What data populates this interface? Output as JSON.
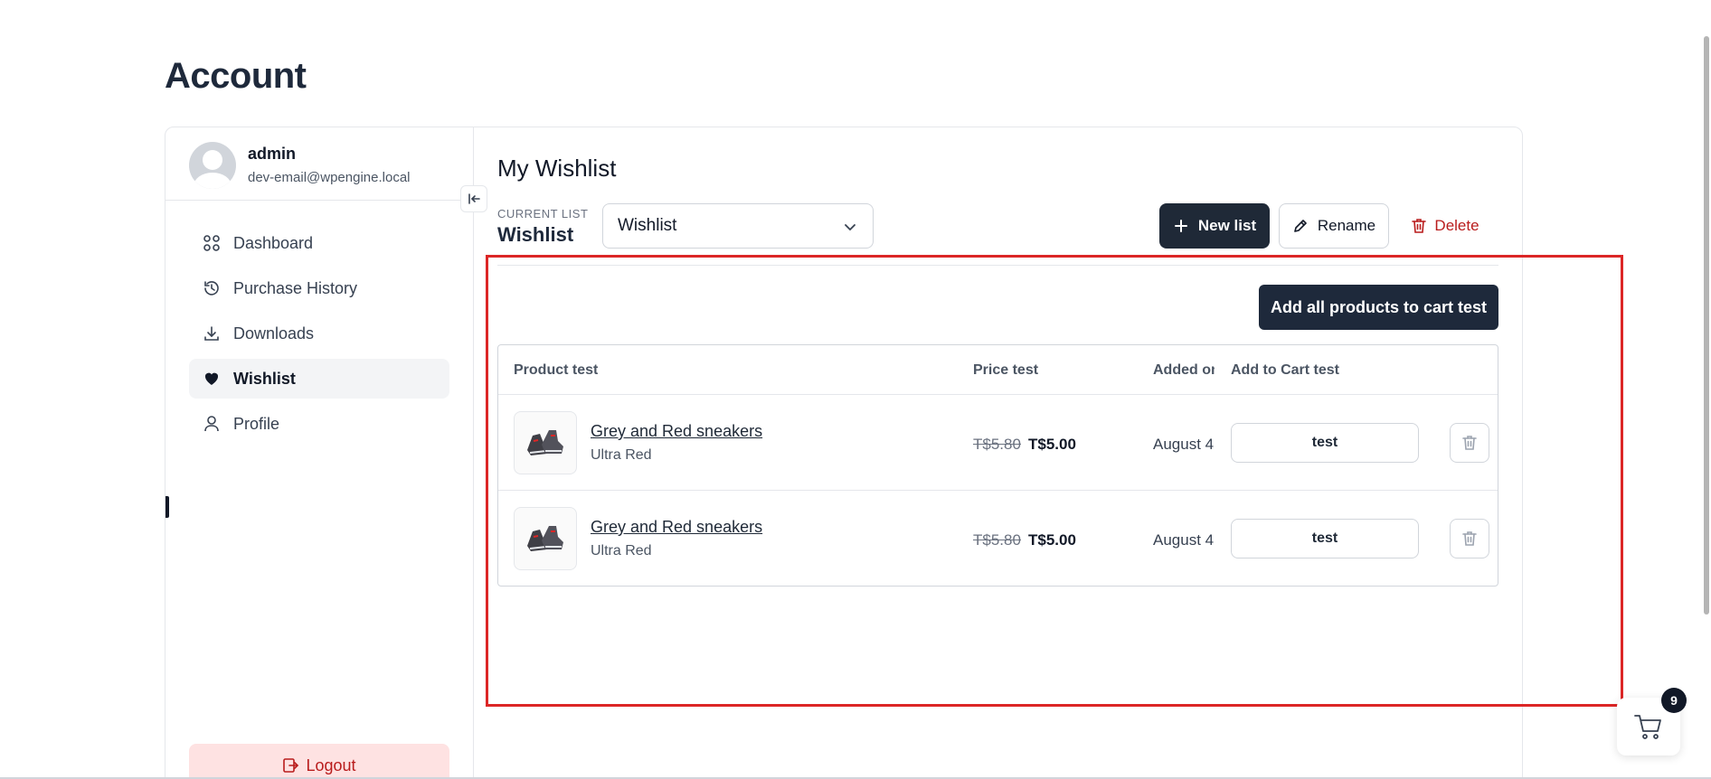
{
  "page": {
    "title": "Account"
  },
  "user": {
    "name": "admin",
    "email": "dev-email@wpengine.local"
  },
  "sidebar": {
    "items": [
      {
        "label": "Dashboard",
        "icon": "grid-icon"
      },
      {
        "label": "Purchase History",
        "icon": "history-icon"
      },
      {
        "label": "Downloads",
        "icon": "download-icon"
      },
      {
        "label": "Wishlist",
        "icon": "heart-icon",
        "active": true
      },
      {
        "label": "Profile",
        "icon": "user-icon"
      }
    ],
    "logout_label": "Logout"
  },
  "wishlist": {
    "title": "My Wishlist",
    "current_list_label": "CURRENT LIST",
    "current_list_value": "Wishlist",
    "select_value": "Wishlist",
    "new_list_label": "New list",
    "rename_label": "Rename",
    "delete_label": "Delete",
    "add_all_label": "Add all products to cart test",
    "columns": {
      "product": "Product test",
      "price": "Price test",
      "added_on": "Added on",
      "add_to_cart": "Add to Cart test"
    },
    "rows": [
      {
        "name": "Grey and Red sneakers",
        "variant": "Ultra Red",
        "price_old": "T$5.80",
        "price_new": "T$5.00",
        "added_on": "August 4",
        "cart_label": "test"
      },
      {
        "name": "Grey and Red sneakers",
        "variant": "Ultra Red",
        "price_old": "T$5.80",
        "price_new": "T$5.00",
        "added_on": "August 4",
        "cart_label": "test"
      }
    ]
  },
  "cart": {
    "count": "9"
  },
  "colors": {
    "primary": "#1e293b",
    "danger": "#b91c1c",
    "highlight": "#dc2626",
    "logout_bg": "#fee2e2"
  }
}
